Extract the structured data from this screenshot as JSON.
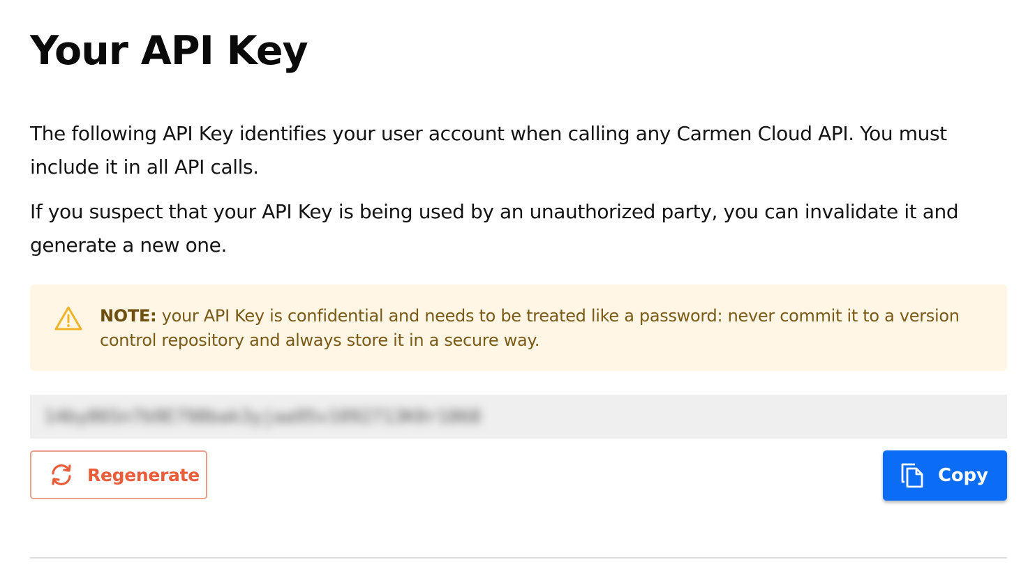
{
  "header": {
    "title": "Your API Key"
  },
  "intro": {
    "paragraph_1": "The following API Key identifies your user account when calling any Carmen Cloud API. You must include it in all API calls.",
    "paragraph_2": "If you suspect that your API Key is being used by an unauthorized party, you can invalidate it and generate a new one."
  },
  "note": {
    "icon": "warning-triangle-icon",
    "label": "NOTE:",
    "text": " your API Key is confidential and needs to be treated like a password: never commit it to a version control repository and always store it in a secure way.",
    "background_color": "#fff6e6",
    "text_color": "#7a5a16",
    "icon_color": "#f1b327"
  },
  "api_key": {
    "value": "14by86Sn7b9E798bak3yjaa95v1092713K0r1868",
    "obscured": true
  },
  "actions": {
    "regenerate": {
      "label": "Regenerate",
      "icon": "refresh-icon",
      "color": "#e95e3a"
    },
    "copy": {
      "label": "Copy",
      "icon": "copy-icon",
      "color": "#0b6cf5"
    }
  }
}
